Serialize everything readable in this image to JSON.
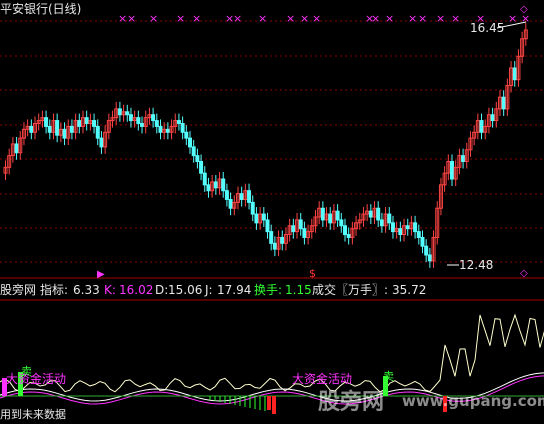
{
  "title": "平安银行(日线)",
  "price_labels": {
    "high": "16.45",
    "low": "12.48"
  },
  "indicator_bar": {
    "source": "股旁网",
    "metric_label": "指标:",
    "metric_value": "6.33",
    "k_label": "K:",
    "k_value": "16.02",
    "d_label": "D:",
    "d_value": "15.06",
    "j_label": "J:",
    "j_value": "17.94",
    "turnover_label": "换手:",
    "turnover_value": "1.15",
    "volume_label": "成交〖万手〗:",
    "volume_value": "35.72"
  },
  "annotations": {
    "tag_left": "大资金活动",
    "tag_right": "大资金活动",
    "sell_left": "卖",
    "sell_right": "卖",
    "footer_left": "用到未来数据",
    "watermark_cn": "股旁网",
    "watermark_url": "www.gupang.com"
  },
  "colors": {
    "up_candle": "#ff4444",
    "down_candle": "#54ffff",
    "magenta": "#ff33ff",
    "grid": "#8b0000",
    "kline": "#ffffff",
    "turnover": "#ffff66",
    "green": "#33ff33"
  },
  "chart_data": {
    "type": "candlestick",
    "title": "平安银行(日线)",
    "high": 16.45,
    "low": 12.48,
    "close_series": [
      14.1,
      14.3,
      14.5,
      14.35,
      14.6,
      14.75,
      14.8,
      14.7,
      14.85,
      14.9,
      14.95,
      14.8,
      14.7,
      14.9,
      14.65,
      14.75,
      14.6,
      14.8,
      14.7,
      14.9,
      14.8,
      14.95,
      14.85,
      14.9,
      14.8,
      14.6,
      14.45,
      14.7,
      14.9,
      14.95,
      15.1,
      15.0,
      15.05,
      15.0,
      14.9,
      14.95,
      14.85,
      14.8,
      14.95,
      15.0,
      14.9,
      14.8,
      14.7,
      14.75,
      14.7,
      14.8,
      14.9,
      14.85,
      14.7,
      14.6,
      14.45,
      14.3,
      14.2,
      14.0,
      13.8,
      13.7,
      13.85,
      13.75,
      13.9,
      13.7,
      13.55,
      13.4,
      13.5,
      13.65,
      13.55,
      13.7,
      13.5,
      13.3,
      13.15,
      13.3,
      13.2,
      13.0,
      12.8,
      12.7,
      12.9,
      12.8,
      12.95,
      13.1,
      13.0,
      13.2,
      13.05,
      12.9,
      13.0,
      13.1,
      13.25,
      13.4,
      13.2,
      13.3,
      13.15,
      13.35,
      13.2,
      13.1,
      12.95,
      12.9,
      13.05,
      13.15,
      13.2,
      13.3,
      13.35,
      13.25,
      13.4,
      13.2,
      13.1,
      13.3,
      13.15,
      13.0,
      13.05,
      12.95,
      13.1,
      13.05,
      13.15,
      13.0,
      12.9,
      12.75,
      12.6,
      12.5,
      12.9,
      13.4,
      13.8,
      14.0,
      14.2,
      13.9,
      14.1,
      14.3,
      14.2,
      14.4,
      14.6,
      14.7,
      14.9,
      14.7,
      14.8,
      15.0,
      14.9,
      15.1,
      15.3,
      15.1,
      15.5,
      15.8,
      15.6,
      16.0,
      16.3,
      16.45
    ]
  }
}
